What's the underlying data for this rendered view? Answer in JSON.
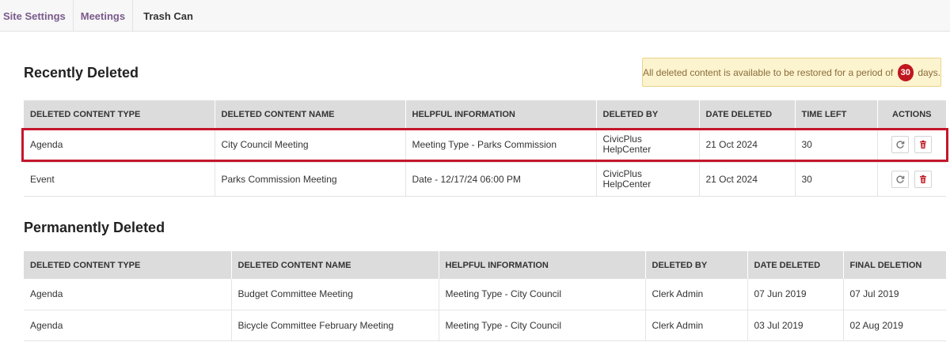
{
  "breadcrumb": {
    "items": [
      {
        "label": "Site Settings"
      },
      {
        "label": "Meetings"
      },
      {
        "label": "Trash Can"
      }
    ]
  },
  "recent": {
    "title": "Recently Deleted",
    "notice": {
      "prefix": "All deleted content is available to be restored for a period of",
      "days": "30",
      "suffix": "days."
    },
    "columns": [
      "DELETED CONTENT TYPE",
      "DELETED CONTENT NAME",
      "HELPFUL INFORMATION",
      "DELETED BY",
      "DATE DELETED",
      "TIME LEFT",
      "ACTIONS"
    ],
    "rows": [
      {
        "type": "Agenda",
        "name": "City Council Meeting",
        "info": "Meeting Type - Parks Commission",
        "deleted_by_1": "CivicPlus",
        "deleted_by_2": "HelpCenter",
        "date": "21 Oct 2024",
        "time_left": "30"
      },
      {
        "type": "Event",
        "name": "Parks Commission Meeting",
        "info": "Date - 12/17/24 06:00 PM",
        "deleted_by_1": "CivicPlus",
        "deleted_by_2": "HelpCenter",
        "date": "21 Oct 2024",
        "time_left": "30"
      }
    ],
    "icons": {
      "restore": "restore-icon",
      "delete": "trash-icon"
    },
    "colors": {
      "delete_icon": "#c0161e",
      "restore_icon": "#777777",
      "highlight": "#c4172c"
    }
  },
  "permanent": {
    "title": "Permanently Deleted",
    "columns": [
      "DELETED CONTENT TYPE",
      "DELETED CONTENT NAME",
      "HELPFUL INFORMATION",
      "DELETED BY",
      "DATE DELETED",
      "FINAL DELETION"
    ],
    "rows": [
      {
        "type": "Agenda",
        "name": "Budget Committee Meeting",
        "info": "Meeting Type - City Council",
        "deleted_by": "Clerk Admin",
        "date": "07 Jun 2019",
        "final": "07 Jul 2019"
      },
      {
        "type": "Agenda",
        "name": "Bicycle Committee February Meeting",
        "info": "Meeting Type - City Council",
        "deleted_by": "Clerk Admin",
        "date": "03 Jul 2019",
        "final": "02 Aug 2019"
      }
    ]
  }
}
